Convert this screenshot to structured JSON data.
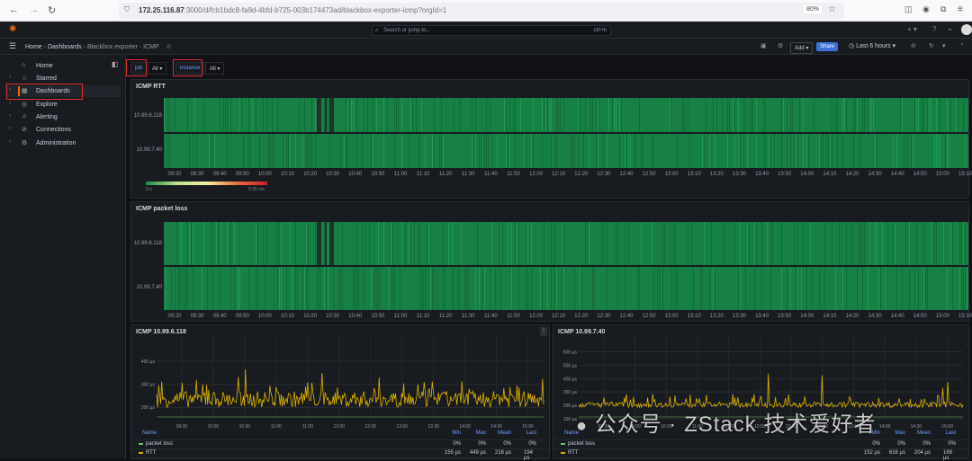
{
  "browser": {
    "url_host": "172.25.116.87",
    "url_rest": ":3000/d/fcb1bdc8-fa9d-4bfd-b725-003b174473ad/blackbox-exporter-icmp?orgId=1",
    "zoom": "80%"
  },
  "topbar": {
    "search_placeholder": "Search or jump to...",
    "shortcut": "ctrl+k"
  },
  "breadcrumb": [
    "Home",
    "Dashboards",
    "Blackbox exporter - ICMP"
  ],
  "toolbar": {
    "add": "Add",
    "share": "Share",
    "time_range": "Last 6 hours"
  },
  "sidebar": {
    "items": [
      {
        "label": "Home",
        "icon": "home-icon"
      },
      {
        "label": "Starred",
        "icon": "star-icon"
      },
      {
        "label": "Dashboards",
        "icon": "grid-icon"
      },
      {
        "label": "Explore",
        "icon": "compass-icon"
      },
      {
        "label": "Alerting",
        "icon": "bell-icon"
      },
      {
        "label": "Connections",
        "icon": "plug-icon"
      },
      {
        "label": "Administration",
        "icon": "gear-icon"
      }
    ]
  },
  "variables": [
    {
      "label": "job",
      "value": "All"
    },
    {
      "label": "instance",
      "value": "All"
    }
  ],
  "colors": {
    "accent": "#3d71d9",
    "highlight": "#e02f2f",
    "heat_ok": "#1a8a4a",
    "rtt": "#e0b400",
    "loss": "#73bf69"
  },
  "heatmap_ticks": [
    "09:20",
    "09:30",
    "09:40",
    "09:50",
    "10:00",
    "10:10",
    "10:20",
    "10:30",
    "10:40",
    "10:50",
    "11:00",
    "11:10",
    "11:20",
    "11:30",
    "11:40",
    "11:50",
    "12:00",
    "12:10",
    "12:20",
    "12:30",
    "12:40",
    "12:50",
    "13:00",
    "13:10",
    "13:20",
    "13:30",
    "13:40",
    "13:50",
    "14:00",
    "14:10",
    "14:20",
    "14:30",
    "14:40",
    "14:50",
    "15:00",
    "15:10"
  ],
  "panels": {
    "rtt": {
      "title": "ICMP RTT",
      "rows": [
        "10.99.6.118",
        "10.99.7.40"
      ],
      "scale_min": "0 s",
      "scale_max": "0.25 ms"
    },
    "loss": {
      "title": "ICMP packet loss",
      "rows": [
        "10.99.6.118",
        "10.99.7.40"
      ]
    },
    "host1": {
      "title": "ICMP 10.99.6.118",
      "yticks": [
        "400 µs",
        "300 µs",
        "200 µs"
      ],
      "xticks": [
        "09:30",
        "10:00",
        "10:30",
        "11:00",
        "11:30",
        "12:00",
        "12:30",
        "13:00",
        "13:30",
        "14:00",
        "14:30",
        "15:00"
      ],
      "legend": {
        "headers": [
          "Name",
          "Min",
          "Max",
          "Mean",
          "Last"
        ],
        "rows": [
          {
            "name": "packet loss",
            "min": "0%",
            "max": "0%",
            "mean": "0%",
            "last": "0%"
          },
          {
            "name": "RTT",
            "min": "155 µs",
            "max": "449 µs",
            "mean": "218 µs",
            "last": "194 µs"
          }
        ]
      }
    },
    "host2": {
      "title": "ICMP 10.99.7.40",
      "yticks": [
        "600 µs",
        "500 µs",
        "400 µs",
        "300 µs",
        "200 µs",
        "100 µs"
      ],
      "xticks": [
        "09:30",
        "10:00",
        "10:30",
        "11:00",
        "11:30",
        "12:00",
        "12:30",
        "13:00",
        "13:30",
        "14:00",
        "14:30",
        "15:00"
      ],
      "legend": {
        "headers": [
          "Name",
          "Min",
          "Max",
          "Mean",
          "Last"
        ],
        "rows": [
          {
            "name": "packet loss",
            "min": "0%",
            "max": "0%",
            "mean": "0%",
            "last": "0%"
          },
          {
            "name": "RTT",
            "min": "152 µs",
            "max": "616 µs",
            "mean": "204 µs",
            "last": "169 µs"
          }
        ]
      }
    }
  },
  "watermark": "公众号 · ZStack 技术爱好者"
}
